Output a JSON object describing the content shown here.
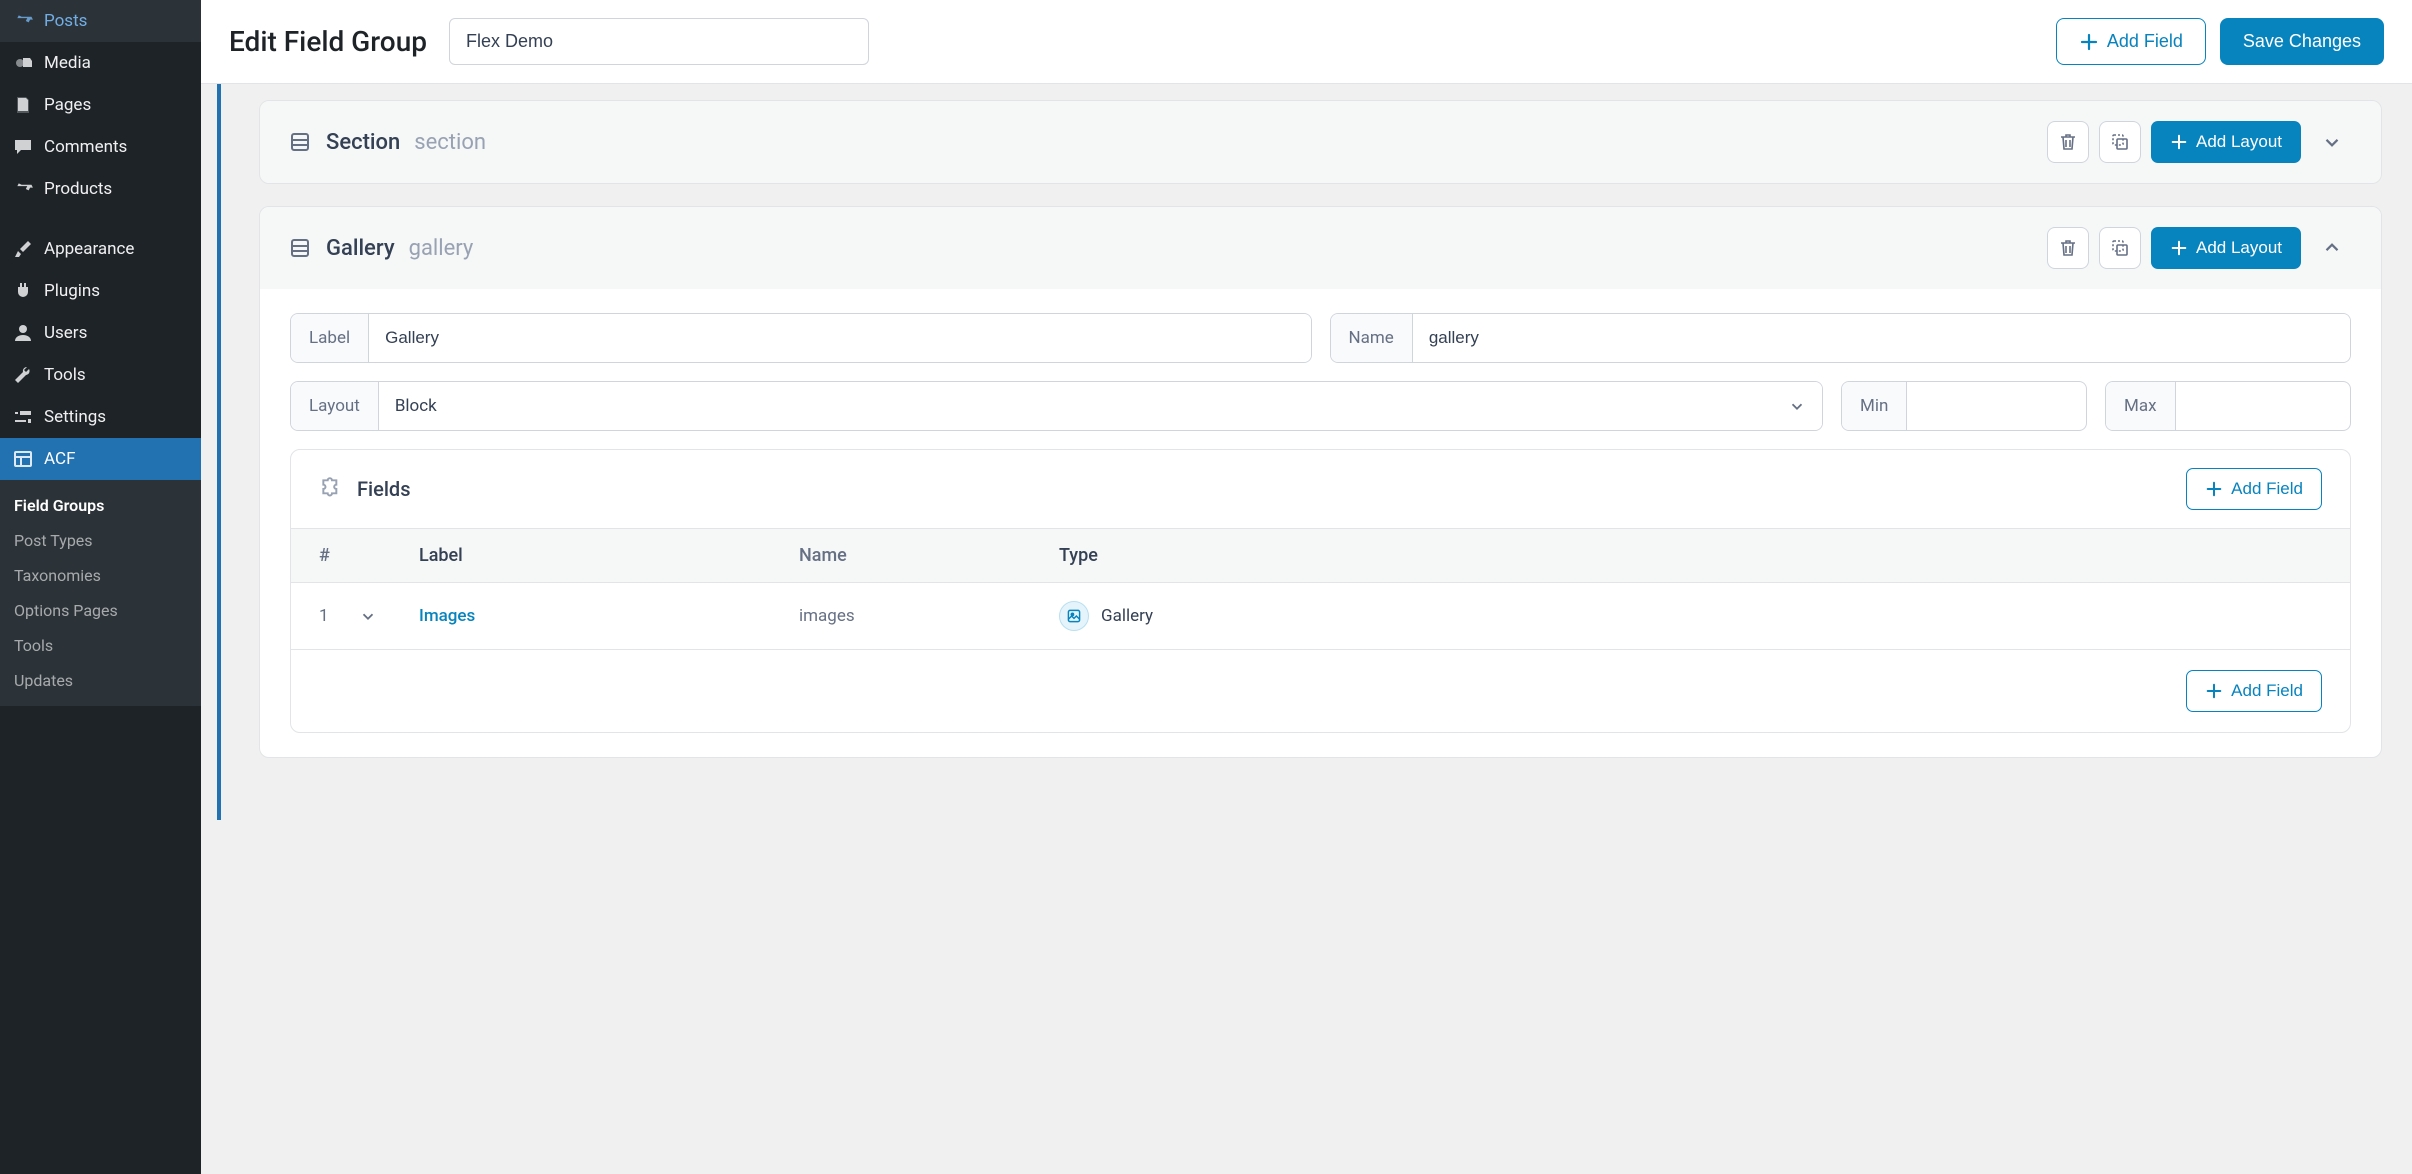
{
  "sidebar": {
    "items": [
      {
        "label": "Posts",
        "icon": "pin"
      },
      {
        "label": "Media",
        "icon": "media"
      },
      {
        "label": "Pages",
        "icon": "page"
      },
      {
        "label": "Comments",
        "icon": "comment"
      },
      {
        "label": "Products",
        "icon": "pin"
      },
      {
        "label": "Appearance",
        "icon": "brush"
      },
      {
        "label": "Plugins",
        "icon": "plug"
      },
      {
        "label": "Users",
        "icon": "user"
      },
      {
        "label": "Tools",
        "icon": "wrench"
      },
      {
        "label": "Settings",
        "icon": "sliders"
      },
      {
        "label": "ACF",
        "icon": "grid",
        "active": true
      }
    ],
    "sub": [
      {
        "label": "Field Groups",
        "current": true
      },
      {
        "label": "Post Types"
      },
      {
        "label": "Taxonomies"
      },
      {
        "label": "Options Pages"
      },
      {
        "label": "Tools"
      },
      {
        "label": "Updates"
      }
    ]
  },
  "header": {
    "page_title": "Edit Field Group",
    "title_value": "Flex Demo",
    "add_field": "Add Field",
    "save": "Save Changes"
  },
  "layouts": [
    {
      "title": "Section",
      "key": "section",
      "add_layout": "Add Layout",
      "expanded": false
    },
    {
      "title": "Gallery",
      "key": "gallery",
      "add_layout": "Add Layout",
      "expanded": true,
      "form": {
        "label_lbl": "Label",
        "label_val": "Gallery",
        "name_lbl": "Name",
        "name_val": "gallery",
        "layout_lbl": "Layout",
        "layout_val": "Block",
        "min_lbl": "Min",
        "min_val": "",
        "max_lbl": "Max",
        "max_val": ""
      },
      "fields_card": {
        "title": "Fields",
        "add_field": "Add Field",
        "columns": {
          "num": "#",
          "label": "Label",
          "name": "Name",
          "type": "Type"
        },
        "rows": [
          {
            "num": "1",
            "label": "Images",
            "name": "images",
            "type": "Gallery"
          }
        ]
      }
    }
  ]
}
